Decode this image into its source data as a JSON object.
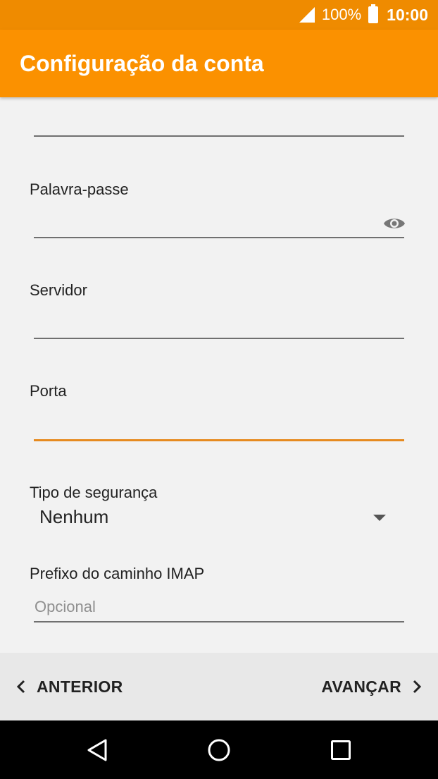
{
  "status_bar": {
    "battery": "100%",
    "time": "10:00"
  },
  "app_bar": {
    "title": "Configuração da conta"
  },
  "form": {
    "password_label": "Palavra-passe",
    "server_label": "Servidor",
    "port_label": "Porta",
    "security_label": "Tipo de segurança",
    "security_value": "Nenhum",
    "imap_prefix_label": "Prefixo do caminho IMAP",
    "imap_prefix_placeholder": "Opcional"
  },
  "footer": {
    "prev_label": "ANTERIOR",
    "next_label": "AVANÇAR"
  },
  "colors": {
    "status_bar": "#ef8b00",
    "app_bar": "#fb9100",
    "accent": "#e68a1f"
  },
  "icons": [
    "signal-icon",
    "battery-icon",
    "eye-icon",
    "dropdown-caret-icon",
    "chevron-left-icon",
    "chevron-right-icon",
    "back-icon",
    "home-icon",
    "recents-icon"
  ]
}
